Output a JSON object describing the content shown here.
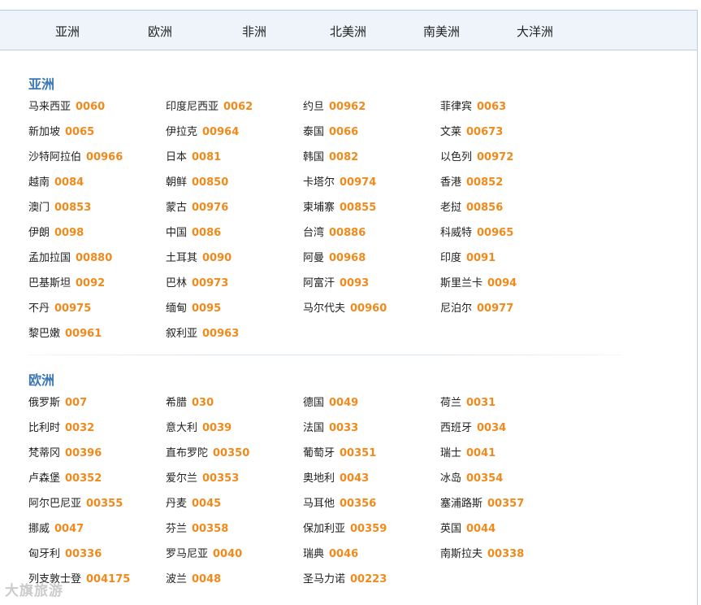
{
  "tabs": [
    "亚洲",
    "欧洲",
    "非洲",
    "北美洲",
    "南美洲",
    "大洋洲"
  ],
  "sections": [
    {
      "title": "亚洲",
      "items": [
        {
          "name": "马来西亚",
          "code": "0060"
        },
        {
          "name": "印度尼西亚",
          "code": "0062"
        },
        {
          "name": "约旦",
          "code": "00962"
        },
        {
          "name": "菲律宾",
          "code": "0063"
        },
        {
          "name": "新加坡",
          "code": "0065"
        },
        {
          "name": "伊拉克",
          "code": "00964"
        },
        {
          "name": "泰国",
          "code": "0066"
        },
        {
          "name": "文莱",
          "code": "00673"
        },
        {
          "name": "沙特阿拉伯",
          "code": "00966"
        },
        {
          "name": "日本",
          "code": "0081"
        },
        {
          "name": "韩国",
          "code": "0082"
        },
        {
          "name": "以色列",
          "code": "00972"
        },
        {
          "name": "越南",
          "code": "0084"
        },
        {
          "name": "朝鲜",
          "code": "00850"
        },
        {
          "name": "卡塔尔",
          "code": "00974"
        },
        {
          "name": "香港",
          "code": "00852"
        },
        {
          "name": "澳门",
          "code": "00853"
        },
        {
          "name": "蒙古",
          "code": "00976"
        },
        {
          "name": "柬埔寨",
          "code": "00855"
        },
        {
          "name": "老挝",
          "code": "00856"
        },
        {
          "name": "伊朗",
          "code": "0098"
        },
        {
          "name": "中国",
          "code": "0086"
        },
        {
          "name": "台湾",
          "code": "00886"
        },
        {
          "name": "科威特",
          "code": "00965"
        },
        {
          "name": "孟加拉国",
          "code": "00880"
        },
        {
          "name": "土耳其",
          "code": "0090"
        },
        {
          "name": "阿曼",
          "code": "00968"
        },
        {
          "name": "印度",
          "code": "0091"
        },
        {
          "name": "巴基斯坦",
          "code": "0092"
        },
        {
          "name": "巴林",
          "code": "00973"
        },
        {
          "name": "阿富汗",
          "code": "0093"
        },
        {
          "name": "斯里兰卡",
          "code": "0094"
        },
        {
          "name": "不丹",
          "code": "00975"
        },
        {
          "name": "缅甸",
          "code": "0095"
        },
        {
          "name": "马尔代夫",
          "code": "00960"
        },
        {
          "name": "尼泊尔",
          "code": "00977"
        },
        {
          "name": "黎巴嫩",
          "code": "00961"
        },
        {
          "name": "叙利亚",
          "code": "00963"
        }
      ]
    },
    {
      "title": "欧洲",
      "items": [
        {
          "name": "俄罗斯",
          "code": "007"
        },
        {
          "name": "希腊",
          "code": "030"
        },
        {
          "name": "德国",
          "code": "0049"
        },
        {
          "name": "荷兰",
          "code": "0031"
        },
        {
          "name": "比利时",
          "code": "0032"
        },
        {
          "name": "意大利",
          "code": "0039"
        },
        {
          "name": "法国",
          "code": "0033"
        },
        {
          "name": "西班牙",
          "code": "0034"
        },
        {
          "name": "梵蒂冈",
          "code": "00396"
        },
        {
          "name": "直布罗陀",
          "code": "00350"
        },
        {
          "name": "葡萄牙",
          "code": "00351"
        },
        {
          "name": "瑞士",
          "code": "0041"
        },
        {
          "name": "卢森堡",
          "code": "00352"
        },
        {
          "name": "爱尔兰",
          "code": "00353"
        },
        {
          "name": "奥地利",
          "code": "0043"
        },
        {
          "name": "冰岛",
          "code": "00354"
        },
        {
          "name": "阿尔巴尼亚",
          "code": "00355"
        },
        {
          "name": "丹麦",
          "code": "0045"
        },
        {
          "name": "马耳他",
          "code": "00356"
        },
        {
          "name": "塞浦路斯",
          "code": "00357"
        },
        {
          "name": "挪威",
          "code": "0047"
        },
        {
          "name": "芬兰",
          "code": "00358"
        },
        {
          "name": "保加利亚",
          "code": "00359"
        },
        {
          "name": "英国",
          "code": "0044"
        },
        {
          "name": "匈牙利",
          "code": "00336"
        },
        {
          "name": "罗马尼亚",
          "code": "0040"
        },
        {
          "name": "瑞典",
          "code": "0046"
        },
        {
          "name": "南斯拉夫",
          "code": "00338"
        },
        {
          "name": "列支敦士登",
          "code": "004175"
        },
        {
          "name": "波兰",
          "code": "0048"
        },
        {
          "name": "圣马力诺",
          "code": "00223"
        }
      ]
    }
  ],
  "watermark": "大旗旅游"
}
